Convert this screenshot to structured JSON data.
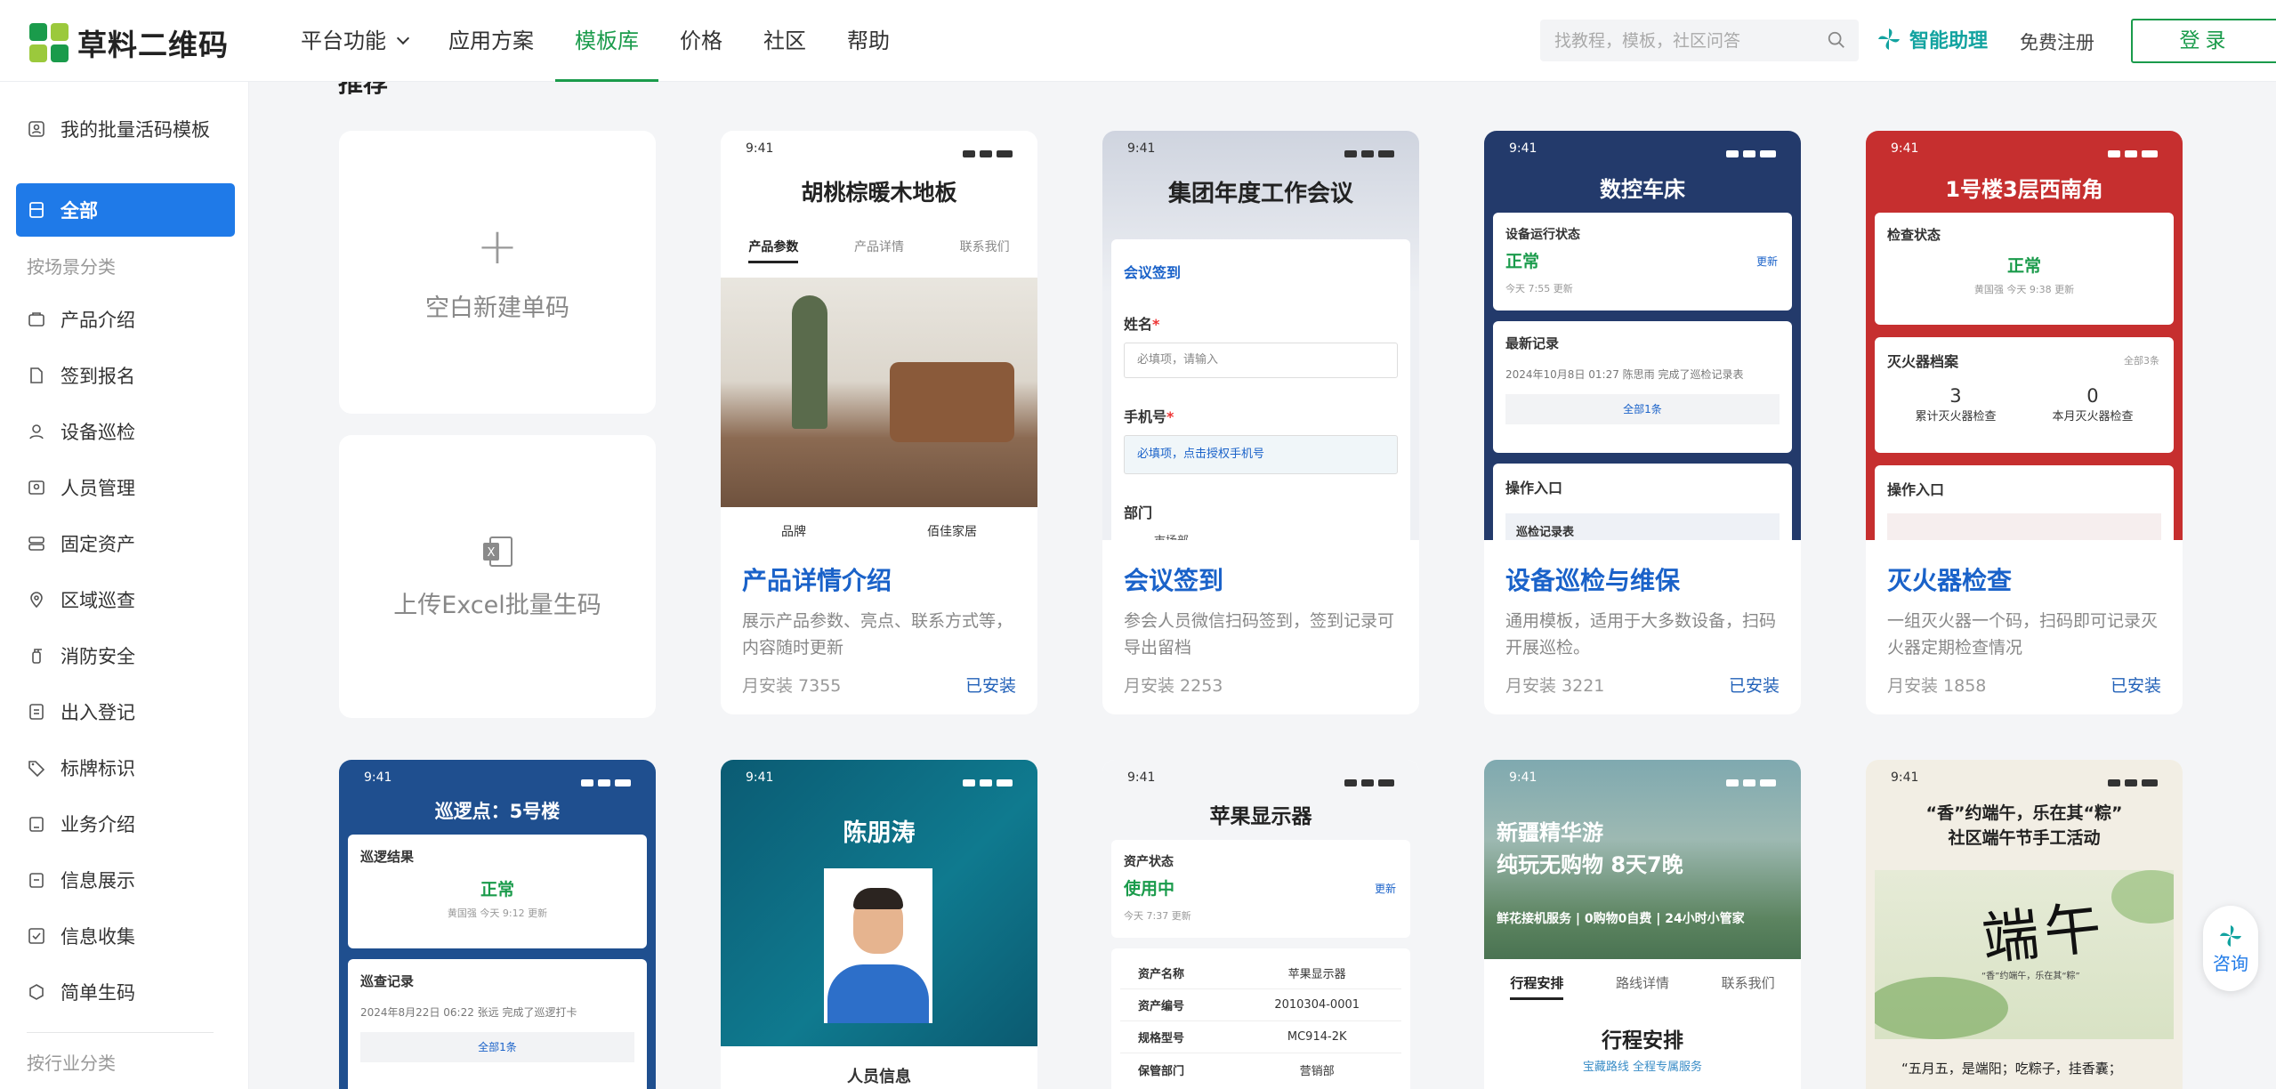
{
  "brand": {
    "name": "草料二维码"
  },
  "nav": {
    "items": [
      "平台功能",
      "应用方案",
      "模板库",
      "价格",
      "社区",
      "帮助"
    ],
    "active": "模板库"
  },
  "search": {
    "placeholder": "找教程，模板，社区问答"
  },
  "header": {
    "assistant": "智能助理",
    "register": "免费注册",
    "login": "登录"
  },
  "sidebar": {
    "top": "我的批量活码模板",
    "all": "全部",
    "group_scene": "按场景分类",
    "items": [
      "产品介绍",
      "签到报名",
      "设备巡检",
      "人员管理",
      "固定资产",
      "区域巡查",
      "消防安全",
      "出入登记",
      "标牌标识",
      "业务介绍",
      "信息展示",
      "信息收集",
      "简单生码"
    ],
    "group_industry": "按行业分类"
  },
  "section_title": "推荐",
  "blank": {
    "new_single": "空白新建单码",
    "excel_upload": "上传Excel批量生码"
  },
  "cards": [
    {
      "title": "产品详情介绍",
      "desc": "展示产品参数、亮点、联系方式等，内容随时更新",
      "installs": "月安装 7355",
      "status": "已安装",
      "preview": {
        "time": "9:41",
        "heading": "胡桃棕暖木地板",
        "tabs": [
          "产品参数",
          "产品详情",
          "联系我们"
        ],
        "row": [
          "品牌",
          "佰佳家居"
        ]
      }
    },
    {
      "title": "会议签到",
      "desc": "参会人员微信扫码签到，签到记录可导出留档",
      "installs": "月安装 2253",
      "status": "",
      "preview": {
        "time": "9:41",
        "heading": "集团年度工作会议",
        "section": "会议签到",
        "name_label": "姓名",
        "name_ph": "必填项，请输入",
        "phone_label": "手机号",
        "phone_ph": "必填项，点击授权手机号",
        "dept_label": "部门",
        "dept_ph": "市场部",
        "required": "*"
      }
    },
    {
      "title": "设备巡检与维保",
      "desc": "通用模板，适用于大多数设备，扫码开展巡检。",
      "installs": "月安装 3221",
      "status": "已安装",
      "preview": {
        "time": "9:41",
        "heading": "数控车床",
        "state_label": "设备运行状态",
        "state": "正常",
        "update": "更新",
        "state_time": "今天 7:55 更新",
        "latest": "最新记录",
        "record": "2024年10月8日 01:27 陈思雨 完成了巡检记录表",
        "all": "全部1条",
        "entry": "操作入口",
        "entry_item": "巡检记录表"
      }
    },
    {
      "title": "灭火器检查",
      "desc": "一组灭火器一个码，扫码即可记录灭火器定期检查情况",
      "installs": "月安装 1858",
      "status": "已安装",
      "preview": {
        "time": "9:41",
        "heading": "1号楼3层西南角",
        "state_label": "检查状态",
        "state": "正常",
        "state_time": "黄国强 今天 9:38 更新",
        "archive": "灭火器档案",
        "all": "全部3条",
        "n1": "3",
        "n1_label": "累计灭火器检查",
        "n2": "0",
        "n2_label": "本月灭火器检查",
        "entry": "操作入口"
      }
    }
  ],
  "row2": [
    {
      "time": "9:41",
      "heading": "巡逻点：5号楼",
      "result_label": "巡逻结果",
      "result": "正常",
      "result_time": "黄国强 今天 9:12 更新",
      "records": "巡查记录",
      "record": "2024年8月22日 06:22 张远 完成了巡逻打卡",
      "all": "全部1条"
    },
    {
      "time": "9:41",
      "heading": "陈朋涛",
      "section": "人员信息"
    },
    {
      "time": "9:41",
      "heading": "苹果显示器",
      "state_label": "资产状态",
      "state": "使用中",
      "update": "更新",
      "state_time": "今天 7:37 更新",
      "rows": [
        [
          "资产名称",
          "苹果显示器"
        ],
        [
          "资产编号",
          "2010304-0001"
        ],
        [
          "规格型号",
          "MC914-2K"
        ],
        [
          "保管部门",
          "营销部"
        ]
      ]
    },
    {
      "time": "9:41",
      "heading1": "新疆精华游",
      "heading2": "纯玩无购物 8天7晚",
      "sub": "鲜花接机服务 | 0购物0自费 | 24小时小管家",
      "tabs": [
        "行程安排",
        "路线详情",
        "联系我们"
      ],
      "section": "行程安排",
      "section_sub": "宝藏路线 全程专属服务"
    },
    {
      "time": "9:41",
      "heading1": "“香”约端午，乐在其“粽”",
      "heading2": "社区端午节手工活动",
      "art": "端午",
      "art_small": "“香”约端午，乐在其“粽”",
      "text": "“五月五，是端阳；吃粽子，挂香囊；"
    }
  ],
  "consult": "咨询",
  "colors": {
    "green": "#1a9b4b",
    "blue": "#1f7ae8",
    "title_blue": "#1a62c9",
    "navy": "#233a6b",
    "red": "#c62f2f"
  }
}
